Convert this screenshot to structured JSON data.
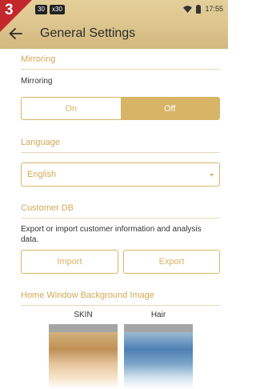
{
  "step": {
    "number": "3"
  },
  "status_bar": {
    "chip_a": "30",
    "chip_b": "x30",
    "time": "17:55",
    "icons": [
      "wifi-icon",
      "battery-icon"
    ]
  },
  "header": {
    "title": "General Settings",
    "back_icon": "back-arrow-icon"
  },
  "mirroring": {
    "section_title": "Mirroring",
    "label": "Mirroring",
    "options": [
      "On",
      "Off"
    ],
    "selected": "Off"
  },
  "language": {
    "section_title": "Language",
    "value": "English",
    "dropdown_icon": "dropdown-triangle-icon"
  },
  "customer_db": {
    "section_title": "Customer DB",
    "description": "Export or import customer information and analysis data.",
    "import_label": "Import",
    "export_label": "Export"
  },
  "background": {
    "section_title": "Home Window Background Image",
    "options": [
      {
        "label": "SKIN"
      },
      {
        "label": "Hair"
      }
    ]
  },
  "colors": {
    "accent": "#d7b466",
    "header": "#dcc48d",
    "badge": "#c3272b"
  }
}
